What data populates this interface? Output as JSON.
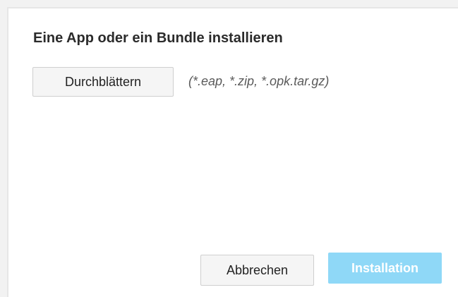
{
  "dialog": {
    "title": "Eine App oder ein Bundle installieren",
    "browse_label": "Durchblättern",
    "file_types_hint": "(*.eap, *.zip, *.opk.tar.gz)",
    "cancel_label": "Abbrechen",
    "install_label": "Installation",
    "install_enabled": false
  },
  "colors": {
    "install_button_disabled": "#8fd8f7",
    "dialog_background": "#ffffff",
    "page_background": "#f2f2f2"
  }
}
